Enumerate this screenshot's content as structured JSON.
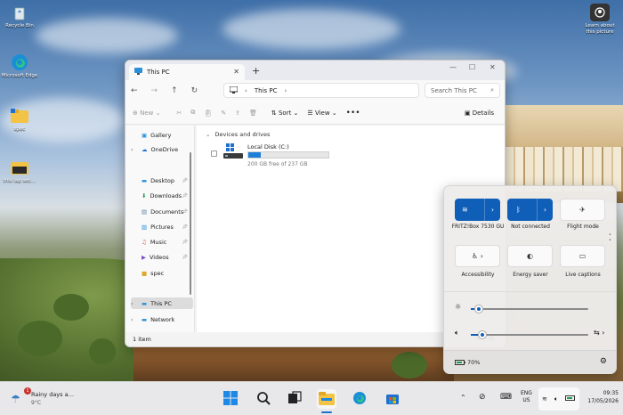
{
  "desktop": {
    "icons": [
      {
        "label": "Recycle Bin",
        "icon": "recycle-bin-icon"
      },
      {
        "label": "Microsoft Edge",
        "icon": "edge-icon"
      },
      {
        "label": "spec",
        "icon": "folder-icon"
      },
      {
        "label": "this lap sec…",
        "icon": "file-icon"
      },
      {
        "label": "Learn about this picture",
        "icon": "camera-icon"
      }
    ]
  },
  "explorer": {
    "tab_title": "This PC",
    "address": "This PC",
    "search_placeholder": "Search This PC",
    "commands": {
      "new": "New",
      "sort": "Sort",
      "view": "View",
      "details": "Details"
    },
    "sidebar": [
      {
        "label": "Gallery",
        "icon": "gallery-icon"
      },
      {
        "label": "OneDrive",
        "icon": "onedrive-icon"
      },
      {
        "label": "Desktop",
        "icon": "desktop-icon"
      },
      {
        "label": "Downloads",
        "icon": "downloads-icon"
      },
      {
        "label": "Documents",
        "icon": "documents-icon"
      },
      {
        "label": "Pictures",
        "icon": "pictures-icon"
      },
      {
        "label": "Music",
        "icon": "music-icon"
      },
      {
        "label": "Videos",
        "icon": "videos-icon"
      },
      {
        "label": "spec",
        "icon": "folder-icon"
      },
      {
        "label": "This PC",
        "icon": "this-pc-icon"
      },
      {
        "label": "Network",
        "icon": "network-icon"
      }
    ],
    "section_header": "Devices and drives",
    "drive": {
      "name": "Local Disk (C:)",
      "free_text": "200 GB free of 237 GB",
      "used_fraction": 0.16
    },
    "status": "1 item"
  },
  "quick_settings": {
    "wifi_label": "FRITZ!Box 7530 GU",
    "bluetooth_label": "Not connected",
    "flight_label": "Flight mode",
    "accessibility_label": "Accessibility",
    "energy_label": "Energy saver",
    "captions_label": "Live captions",
    "brightness_fraction": 0.07,
    "volume_fraction": 0.1,
    "battery": "70%",
    "accent": "#0f5fb8"
  },
  "taskbar": {
    "weather_text": "Rainy days a…",
    "weather_temp": "9°C",
    "weather_badge": "1",
    "lang_top": "ENG",
    "lang_bottom": "US",
    "time": "09:35",
    "date": "17/05/2026"
  }
}
